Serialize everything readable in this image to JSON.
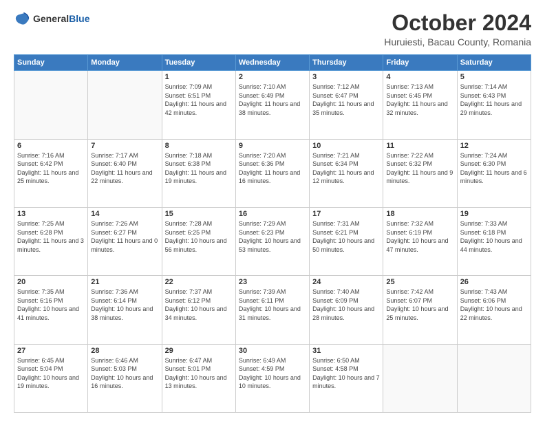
{
  "header": {
    "logo": {
      "general": "General",
      "blue": "Blue"
    },
    "title": "October 2024",
    "location": "Huruiesti, Bacau County, Romania"
  },
  "days_of_week": [
    "Sunday",
    "Monday",
    "Tuesday",
    "Wednesday",
    "Thursday",
    "Friday",
    "Saturday"
  ],
  "weeks": [
    [
      {
        "day": "",
        "sunrise": "",
        "sunset": "",
        "daylight": ""
      },
      {
        "day": "",
        "sunrise": "",
        "sunset": "",
        "daylight": ""
      },
      {
        "day": "1",
        "sunrise": "Sunrise: 7:09 AM",
        "sunset": "Sunset: 6:51 PM",
        "daylight": "Daylight: 11 hours and 42 minutes."
      },
      {
        "day": "2",
        "sunrise": "Sunrise: 7:10 AM",
        "sunset": "Sunset: 6:49 PM",
        "daylight": "Daylight: 11 hours and 38 minutes."
      },
      {
        "day": "3",
        "sunrise": "Sunrise: 7:12 AM",
        "sunset": "Sunset: 6:47 PM",
        "daylight": "Daylight: 11 hours and 35 minutes."
      },
      {
        "day": "4",
        "sunrise": "Sunrise: 7:13 AM",
        "sunset": "Sunset: 6:45 PM",
        "daylight": "Daylight: 11 hours and 32 minutes."
      },
      {
        "day": "5",
        "sunrise": "Sunrise: 7:14 AM",
        "sunset": "Sunset: 6:43 PM",
        "daylight": "Daylight: 11 hours and 29 minutes."
      }
    ],
    [
      {
        "day": "6",
        "sunrise": "Sunrise: 7:16 AM",
        "sunset": "Sunset: 6:42 PM",
        "daylight": "Daylight: 11 hours and 25 minutes."
      },
      {
        "day": "7",
        "sunrise": "Sunrise: 7:17 AM",
        "sunset": "Sunset: 6:40 PM",
        "daylight": "Daylight: 11 hours and 22 minutes."
      },
      {
        "day": "8",
        "sunrise": "Sunrise: 7:18 AM",
        "sunset": "Sunset: 6:38 PM",
        "daylight": "Daylight: 11 hours and 19 minutes."
      },
      {
        "day": "9",
        "sunrise": "Sunrise: 7:20 AM",
        "sunset": "Sunset: 6:36 PM",
        "daylight": "Daylight: 11 hours and 16 minutes."
      },
      {
        "day": "10",
        "sunrise": "Sunrise: 7:21 AM",
        "sunset": "Sunset: 6:34 PM",
        "daylight": "Daylight: 11 hours and 12 minutes."
      },
      {
        "day": "11",
        "sunrise": "Sunrise: 7:22 AM",
        "sunset": "Sunset: 6:32 PM",
        "daylight": "Daylight: 11 hours and 9 minutes."
      },
      {
        "day": "12",
        "sunrise": "Sunrise: 7:24 AM",
        "sunset": "Sunset: 6:30 PM",
        "daylight": "Daylight: 11 hours and 6 minutes."
      }
    ],
    [
      {
        "day": "13",
        "sunrise": "Sunrise: 7:25 AM",
        "sunset": "Sunset: 6:28 PM",
        "daylight": "Daylight: 11 hours and 3 minutes."
      },
      {
        "day": "14",
        "sunrise": "Sunrise: 7:26 AM",
        "sunset": "Sunset: 6:27 PM",
        "daylight": "Daylight: 11 hours and 0 minutes."
      },
      {
        "day": "15",
        "sunrise": "Sunrise: 7:28 AM",
        "sunset": "Sunset: 6:25 PM",
        "daylight": "Daylight: 10 hours and 56 minutes."
      },
      {
        "day": "16",
        "sunrise": "Sunrise: 7:29 AM",
        "sunset": "Sunset: 6:23 PM",
        "daylight": "Daylight: 10 hours and 53 minutes."
      },
      {
        "day": "17",
        "sunrise": "Sunrise: 7:31 AM",
        "sunset": "Sunset: 6:21 PM",
        "daylight": "Daylight: 10 hours and 50 minutes."
      },
      {
        "day": "18",
        "sunrise": "Sunrise: 7:32 AM",
        "sunset": "Sunset: 6:19 PM",
        "daylight": "Daylight: 10 hours and 47 minutes."
      },
      {
        "day": "19",
        "sunrise": "Sunrise: 7:33 AM",
        "sunset": "Sunset: 6:18 PM",
        "daylight": "Daylight: 10 hours and 44 minutes."
      }
    ],
    [
      {
        "day": "20",
        "sunrise": "Sunrise: 7:35 AM",
        "sunset": "Sunset: 6:16 PM",
        "daylight": "Daylight: 10 hours and 41 minutes."
      },
      {
        "day": "21",
        "sunrise": "Sunrise: 7:36 AM",
        "sunset": "Sunset: 6:14 PM",
        "daylight": "Daylight: 10 hours and 38 minutes."
      },
      {
        "day": "22",
        "sunrise": "Sunrise: 7:37 AM",
        "sunset": "Sunset: 6:12 PM",
        "daylight": "Daylight: 10 hours and 34 minutes."
      },
      {
        "day": "23",
        "sunrise": "Sunrise: 7:39 AM",
        "sunset": "Sunset: 6:11 PM",
        "daylight": "Daylight: 10 hours and 31 minutes."
      },
      {
        "day": "24",
        "sunrise": "Sunrise: 7:40 AM",
        "sunset": "Sunset: 6:09 PM",
        "daylight": "Daylight: 10 hours and 28 minutes."
      },
      {
        "day": "25",
        "sunrise": "Sunrise: 7:42 AM",
        "sunset": "Sunset: 6:07 PM",
        "daylight": "Daylight: 10 hours and 25 minutes."
      },
      {
        "day": "26",
        "sunrise": "Sunrise: 7:43 AM",
        "sunset": "Sunset: 6:06 PM",
        "daylight": "Daylight: 10 hours and 22 minutes."
      }
    ],
    [
      {
        "day": "27",
        "sunrise": "Sunrise: 6:45 AM",
        "sunset": "Sunset: 5:04 PM",
        "daylight": "Daylight: 10 hours and 19 minutes."
      },
      {
        "day": "28",
        "sunrise": "Sunrise: 6:46 AM",
        "sunset": "Sunset: 5:03 PM",
        "daylight": "Daylight: 10 hours and 16 minutes."
      },
      {
        "day": "29",
        "sunrise": "Sunrise: 6:47 AM",
        "sunset": "Sunset: 5:01 PM",
        "daylight": "Daylight: 10 hours and 13 minutes."
      },
      {
        "day": "30",
        "sunrise": "Sunrise: 6:49 AM",
        "sunset": "Sunset: 4:59 PM",
        "daylight": "Daylight: 10 hours and 10 minutes."
      },
      {
        "day": "31",
        "sunrise": "Sunrise: 6:50 AM",
        "sunset": "Sunset: 4:58 PM",
        "daylight": "Daylight: 10 hours and 7 minutes."
      },
      {
        "day": "",
        "sunrise": "",
        "sunset": "",
        "daylight": ""
      },
      {
        "day": "",
        "sunrise": "",
        "sunset": "",
        "daylight": ""
      }
    ]
  ]
}
